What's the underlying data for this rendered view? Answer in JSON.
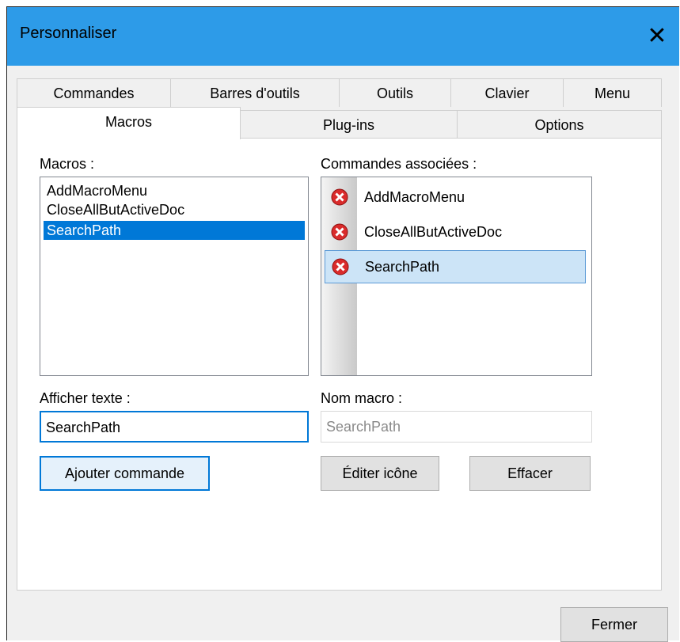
{
  "window": {
    "title": "Personnaliser",
    "close_glyph": "✕"
  },
  "tabs_top": [
    "Commandes",
    "Barres d'outils",
    "Outils",
    "Clavier",
    "Menu"
  ],
  "tabs_bottom": {
    "active": "Macros",
    "plugins": "Plug-ins",
    "options": "Options"
  },
  "macros": {
    "label": "Macros :",
    "items": [
      "AddMacroMenu",
      "CloseAllButActiveDoc",
      "SearchPath"
    ],
    "selected": "SearchPath"
  },
  "commands": {
    "label": "Commandes associées :",
    "items": [
      "AddMacroMenu",
      "CloseAllButActiveDoc",
      "SearchPath"
    ],
    "icon": "error-icon"
  },
  "display_text": {
    "label": "Afficher texte :",
    "value": "SearchPath"
  },
  "macro_name": {
    "label": "Nom macro :",
    "value": "SearchPath"
  },
  "buttons": {
    "add_command": "Ajouter commande",
    "edit_icon": "Éditer icône",
    "delete": "Effacer",
    "close": "Fermer"
  },
  "colors": {
    "titlebar": "#2d9be8",
    "selection": "#0078d7",
    "icon_red": "#d92b2b"
  }
}
